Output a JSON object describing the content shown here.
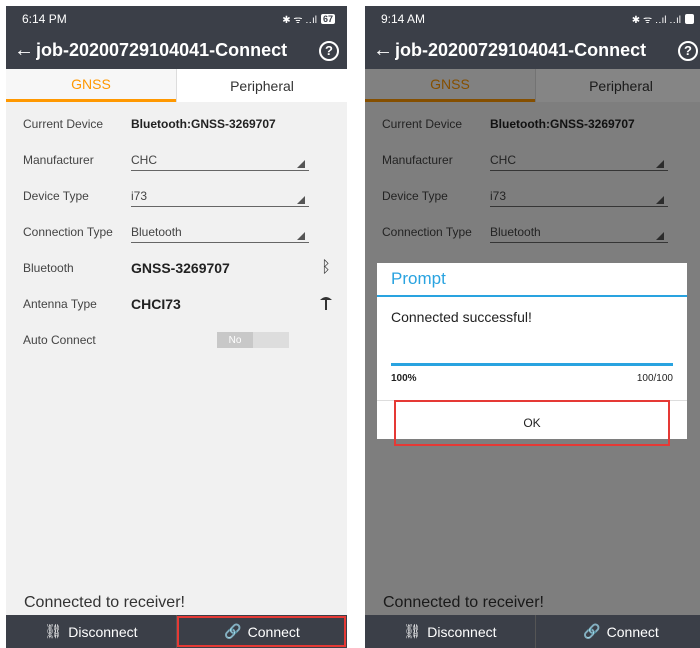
{
  "left": {
    "status": {
      "time": "6:14 PM",
      "icons": "✱ ᯤ ‥ıl",
      "battery": "67"
    },
    "title": "job-20200729104041-Connect",
    "tabs": [
      "GNSS",
      "Peripheral"
    ],
    "rows": {
      "current_device": {
        "label": "Current Device",
        "value": "Bluetooth:GNSS-3269707"
      },
      "manufacturer": {
        "label": "Manufacturer",
        "value": "CHC"
      },
      "device_type": {
        "label": "Device Type",
        "value": "i73"
      },
      "connection_type": {
        "label": "Connection Type",
        "value": "Bluetooth"
      },
      "bluetooth": {
        "label": "Bluetooth",
        "value": "GNSS-3269707"
      },
      "antenna": {
        "label": "Antenna Type",
        "value": "CHCI73"
      },
      "auto_connect": {
        "label": "Auto Connect",
        "value": "No"
      }
    },
    "footer_msg": "Connected to receiver!",
    "disconnect": "Disconnect",
    "connect": "Connect"
  },
  "right": {
    "status": {
      "time": "9:14 AM",
      "icons": "✱ ᯤ ‥ıl ‥ıl",
      "battery": ""
    },
    "title": "job-20200729104041-Connect",
    "tabs": [
      "GNSS",
      "Peripheral"
    ],
    "rows": {
      "current_device": {
        "label": "Current Device",
        "value": "Bluetooth:GNSS-3269707"
      },
      "manufacturer": {
        "label": "Manufacturer",
        "value": "CHC"
      },
      "device_type": {
        "label": "Device Type",
        "value": "i73"
      },
      "connection_type": {
        "label": "Connection Type",
        "value": "Bluetooth"
      }
    },
    "dialog": {
      "title": "Prompt",
      "message": "Connected successful!",
      "progress_percent": "100%",
      "progress_count": "100/100",
      "ok": "OK"
    },
    "footer_msg": "Connected to receiver!",
    "disconnect": "Disconnect",
    "connect": "Connect"
  },
  "colors": {
    "bar": "#3b3f48",
    "accent": "#ff9800",
    "dialog_blue": "#29a3e0",
    "highlight": "#e53935"
  },
  "icons": {
    "back": "back-arrow-icon",
    "help": "help-icon",
    "bluetooth": "bluetooth-icon",
    "antenna": "antenna-icon",
    "link": "link-icon",
    "unlink": "unlink-icon"
  }
}
